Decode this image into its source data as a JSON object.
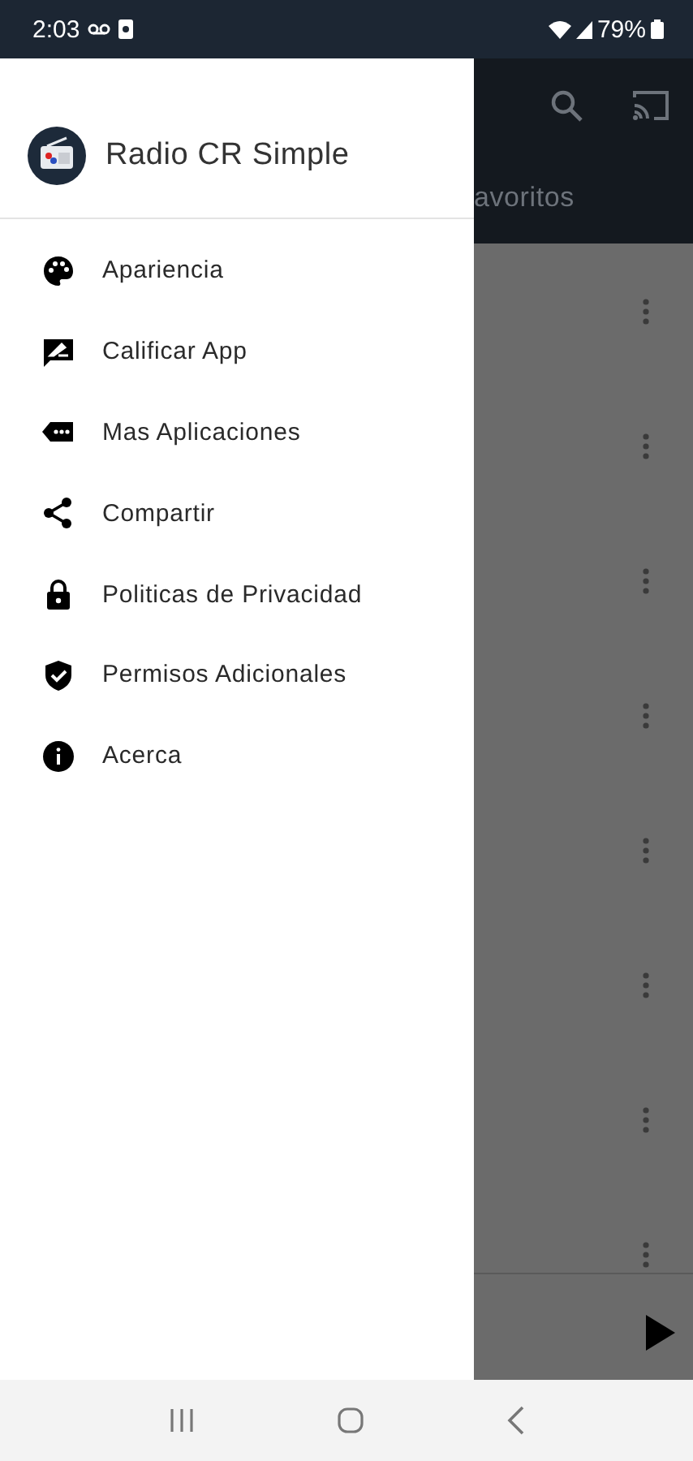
{
  "status_bar": {
    "time": "2:03",
    "battery": "79%"
  },
  "app_bar": {
    "tab_label": "avoritos"
  },
  "drawer": {
    "title": "Radio CR Simple",
    "items": [
      {
        "label": "Apariencia"
      },
      {
        "label": "Calificar App"
      },
      {
        "label": "Mas Aplicaciones"
      },
      {
        "label": "Compartir"
      },
      {
        "label": "Politicas de Privacidad"
      },
      {
        "label": "Permisos Adicionales"
      },
      {
        "label": "Acerca"
      }
    ]
  }
}
